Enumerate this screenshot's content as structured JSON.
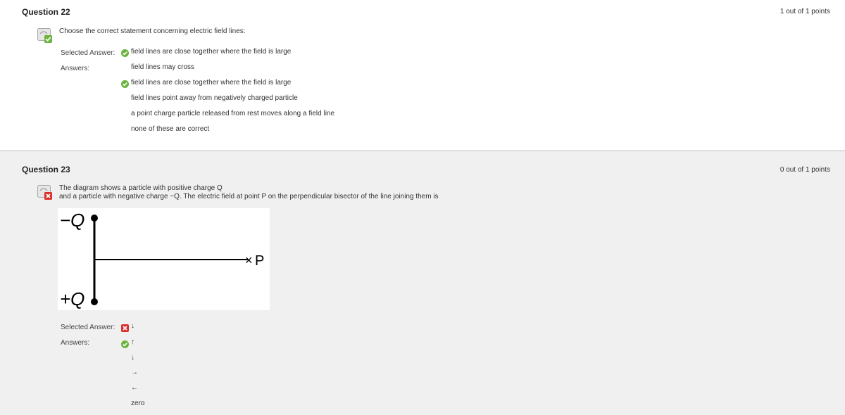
{
  "q22": {
    "title": "Question 22",
    "points": "1 out of 1 points",
    "prompt": "Choose the correct statement concerning electric field lines:",
    "selected_label": "Selected Answer:",
    "selected_answer": "field lines are close together where the field is large",
    "answers_label": "Answers:",
    "answers": [
      "field lines may cross",
      "field lines are close together where the field is large",
      "field lines point away from negatively charged particle",
      "a point charge particle released from rest moves along a field line",
      "none of these are correct"
    ],
    "correct_answer_index": 1,
    "status": "correct"
  },
  "q23": {
    "title": "Question 23",
    "points": "0 out of 1 points",
    "prompt_line1": "The diagram shows a particle with positive charge Q",
    "prompt_line2": "and a particle with negative charge −Q. The electric field at point P on the perpendicular bisector of the line joining them is",
    "diagram": {
      "top_charge": "−Q",
      "bottom_charge": "+Q",
      "point": "P",
      "point_marker": "×"
    },
    "selected_label": "Selected Answer:",
    "selected_answer": "↓",
    "answers_label": "Answers:",
    "answers": [
      "↑",
      "↓",
      "→",
      "←",
      "zero"
    ],
    "correct_answer_index": 0,
    "status": "incorrect"
  },
  "colors": {
    "correct_green": "#6cb33f",
    "incorrect_red": "#d9302c",
    "divider": "#b9b9b9",
    "q23_background": "#f0f0f0"
  },
  "icons": {
    "question_correct": "question-correct-icon",
    "question_incorrect": "question-incorrect-icon",
    "check": "check-icon",
    "cross": "x-icon"
  }
}
